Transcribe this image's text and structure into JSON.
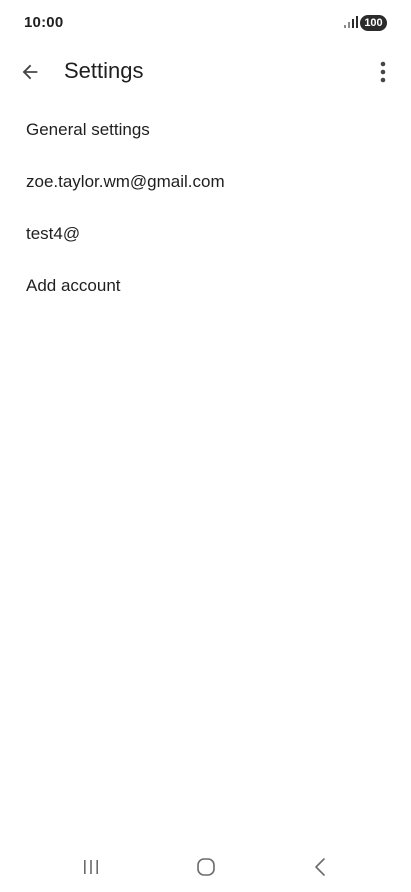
{
  "status_bar": {
    "time": "10:00",
    "battery": "100",
    "icons": [
      "signal-icon"
    ]
  },
  "app_bar": {
    "title": "Settings",
    "icons": [
      "arrow-back-icon",
      "more-vert-icon"
    ]
  },
  "settings": {
    "items": [
      {
        "label": "General settings"
      },
      {
        "label": "zoe.taylor.wm@gmail.com"
      },
      {
        "label": "test4@"
      },
      {
        "label": "Add account"
      }
    ]
  },
  "nav_bar": {
    "icons": [
      "recents-icon",
      "home-icon",
      "nav-back-icon"
    ]
  },
  "colors": {
    "background": "#ffffff",
    "text": "#1f1f1f",
    "icon": "#444746",
    "battery_badge": "#2b2b2b",
    "nav_icon": "#6b6b6b"
  }
}
